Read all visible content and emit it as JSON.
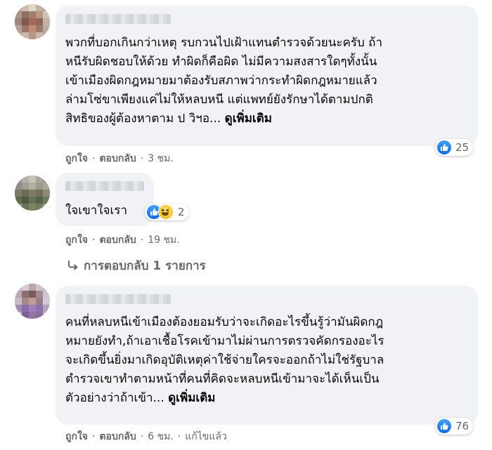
{
  "comments": [
    {
      "text_lines": [
        "พวกที่บอกเกินกว่าเหตุ รบกวนไปเฝ้าแทนตำรวจด้วยนะครับ ถ้า",
        "หนีรับผิดชอบให้ด้วย ทำผิดก็คือผิด ไม่มีความสงสารใดๆทั้งนั้น",
        "เข้าเมืองผิดกฎหมายมาต้องรับสภาพว่ากระทำผิดกฎหมายแล้ว",
        "ล่ามโซ่ขาเพียงแค่ไม่ให้หลบหนี แต่แพทย์ยังรักษาได้ตามปกติ",
        "สิทธิของผู้ต้องหาตาม ป วิฯอ..."
      ],
      "see_more": "ดูเพิ่มเติม",
      "like": "ถูกใจ",
      "reply": "ตอบกลับ",
      "time": "3 ชม.",
      "reaction_count": "25",
      "reaction_icons": [
        "like-icon"
      ]
    },
    {
      "text_lines": [
        "ใจเขาใจเรา"
      ],
      "like": "ถูกใจ",
      "reply": "ตอบกลับ",
      "time": "19 ชม.",
      "reaction_count": "2",
      "reaction_icons": [
        "like-icon",
        "haha-icon"
      ],
      "replies_label": "การตอบกลับ 1 รายการ"
    },
    {
      "text_lines": [
        "คนที่หลบหนีเข้าเมืองต้องยอมรับว่าจะเกิดอะไรขึ้นรู้ว่ามันผิดกฎ",
        "หมายยังทำ,ถ้าเอาเชื้อโรคเข้ามาไม่ผ่านการตรวจคัดกรองอะไร",
        "จะเกิดขึ้นยิ่งมาเกิดอุบัติเหตุค่าใช้จ่ายใครจะออกถ้าไม่ใช่รัฐบาล",
        "ตำรวจเขาทำตามหน้าที่คนที่คิดจะหลบหนีเข้ามาจะได้เห็นเป็น",
        "ตัวอย่างว่าถ้าเข้า..."
      ],
      "see_more": "ดูเพิ่มเติม",
      "like": "ถูกใจ",
      "reply": "ตอบกลับ",
      "time": "6 ชม.",
      "edited": "แก้ไขแล้ว",
      "reaction_count": "76",
      "reaction_icons": [
        "like-icon"
      ]
    }
  ],
  "colors": {
    "bubble": "#f0f2f5",
    "meta": "#65676b",
    "like_blue": "#1877f2",
    "text": "#050505"
  }
}
